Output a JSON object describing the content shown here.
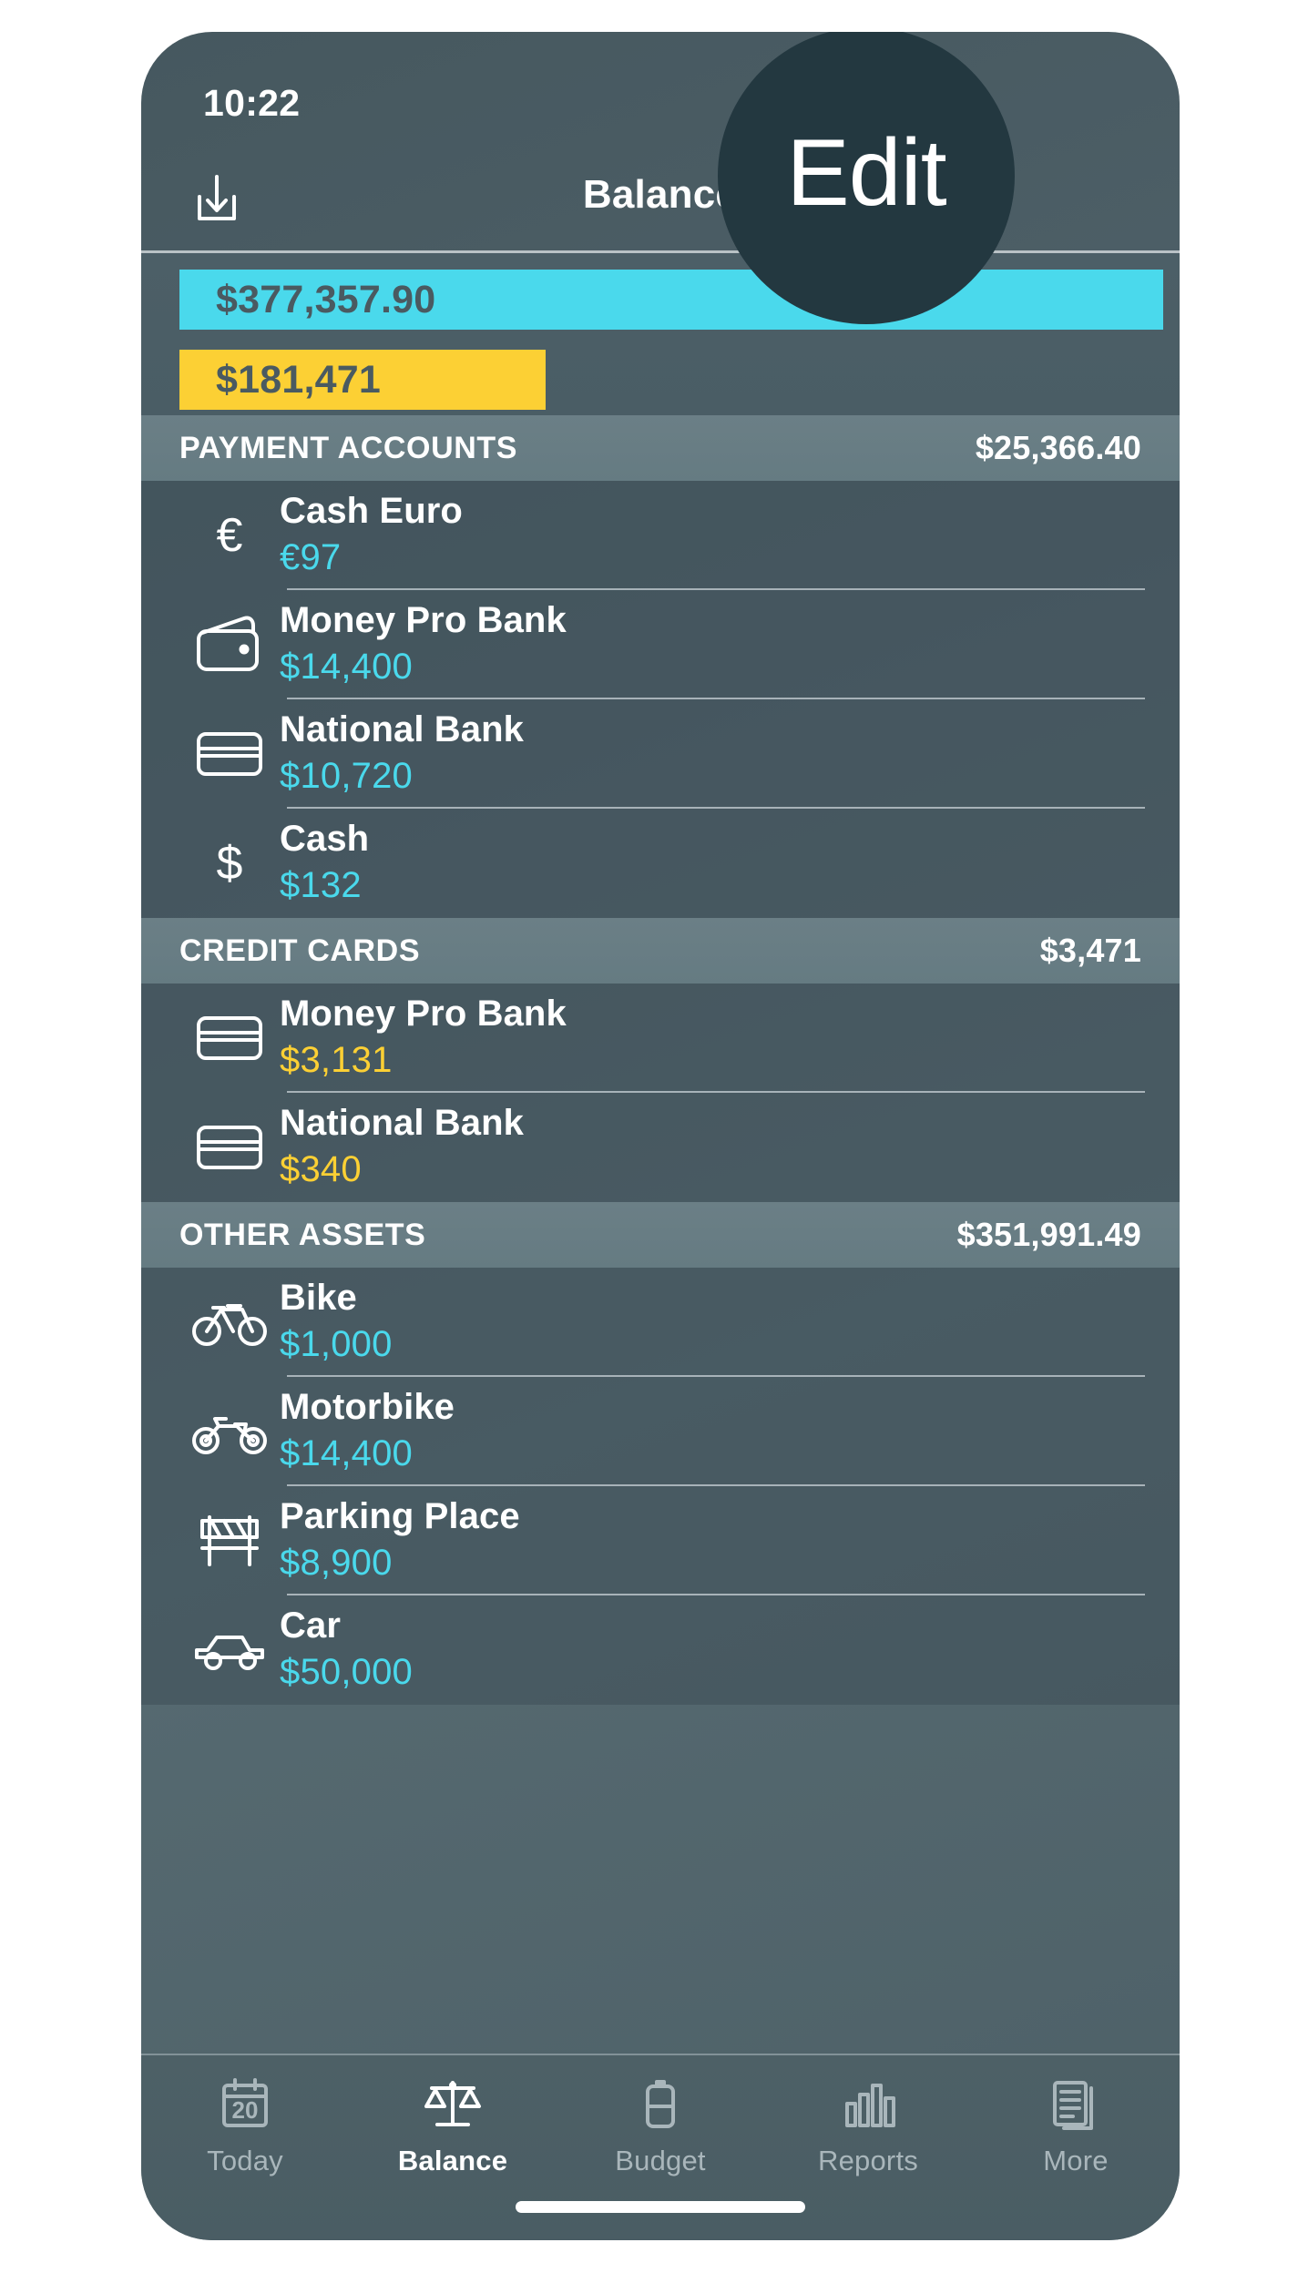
{
  "status": {
    "time": "10:22"
  },
  "nav": {
    "title": "Balance",
    "import_icon": "download-box-icon",
    "edit_label": "Edit"
  },
  "totals": {
    "assets": "$377,357.90",
    "debts": "$181,471",
    "assets_color": "#4ad9ec",
    "debts_color": "#fcd034"
  },
  "sections": [
    {
      "title": "PAYMENT ACCOUNTS",
      "amount": "$25,366.40",
      "rows": [
        {
          "icon": "euro-currency-icon",
          "name": "Cash Euro",
          "amount": "€97",
          "sign": "pos"
        },
        {
          "icon": "wallet-icon",
          "name": "Money Pro Bank",
          "amount": "$14,400",
          "sign": "pos"
        },
        {
          "icon": "credit-card-icon",
          "name": "National Bank",
          "amount": "$10,720",
          "sign": "pos"
        },
        {
          "icon": "dollar-currency-icon",
          "name": "Cash",
          "amount": "$132",
          "sign": "pos"
        }
      ]
    },
    {
      "title": "CREDIT CARDS",
      "amount": "$3,471",
      "rows": [
        {
          "icon": "credit-card-icon",
          "name": "Money Pro Bank",
          "amount": "$3,131",
          "sign": "neg"
        },
        {
          "icon": "credit-card-icon",
          "name": "National Bank",
          "amount": "$340",
          "sign": "neg"
        }
      ]
    },
    {
      "title": "OTHER ASSETS",
      "amount": "$351,991.49",
      "rows": [
        {
          "icon": "bicycle-icon",
          "name": "Bike",
          "amount": "$1,000",
          "sign": "pos"
        },
        {
          "icon": "motorbike-icon",
          "name": "Motorbike",
          "amount": "$14,400",
          "sign": "pos"
        },
        {
          "icon": "road-barrier-icon",
          "name": "Parking Place",
          "amount": "$8,900",
          "sign": "pos"
        },
        {
          "icon": "car-icon",
          "name": "Car",
          "amount": "$50,000",
          "sign": "pos"
        }
      ]
    }
  ],
  "tabs": [
    {
      "label": "Today",
      "icon": "calendar-icon",
      "badge": "20",
      "active": false
    },
    {
      "label": "Balance",
      "icon": "scales-icon",
      "active": true
    },
    {
      "label": "Budget",
      "icon": "battery-icon",
      "active": false
    },
    {
      "label": "Reports",
      "icon": "bar-chart-icon",
      "active": false
    },
    {
      "label": "More",
      "icon": "documents-icon",
      "active": false
    }
  ]
}
